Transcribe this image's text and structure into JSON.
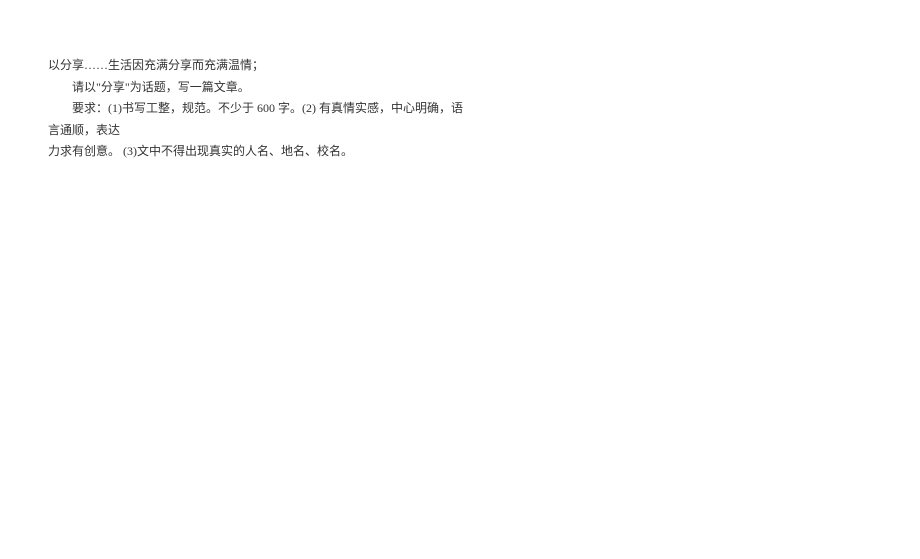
{
  "document": {
    "line1": "以分享……生活因充满分享而充满温情；",
    "line2": "请以\"分享\"为话题，写一篇文章。",
    "line3": "要求：(1)书写工整，规范。不少于 600 字。(2) 有真情实感，中心明确，语言通顺，表达",
    "line4": "力求有创意。 (3)文中不得出现真实的人名、地名、校名。"
  }
}
